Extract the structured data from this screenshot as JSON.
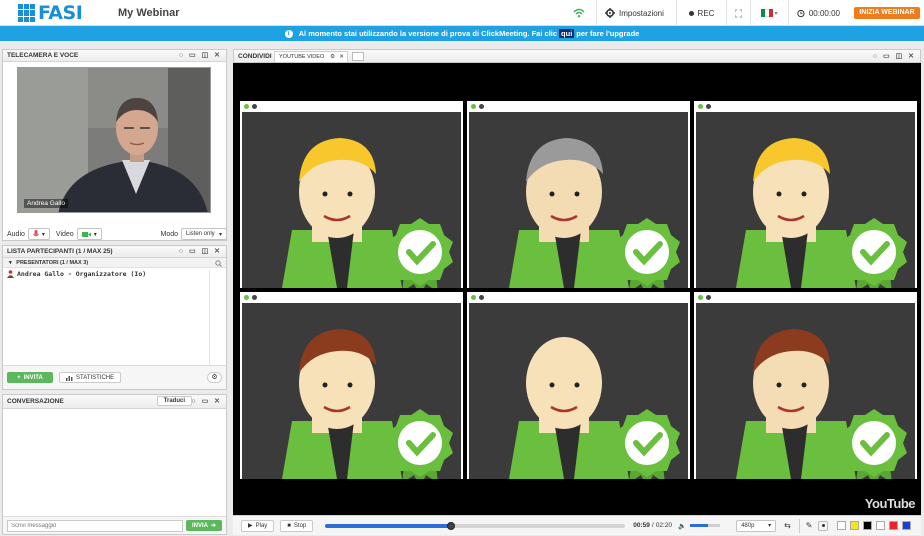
{
  "topbar": {
    "logo_text": "FASI",
    "webinar_title": "My Webinar",
    "settings_label": "Impostazioni",
    "rec_label": "REC",
    "timer": "00:00:00",
    "start_label": "INIZIA WEBINAR"
  },
  "notice": {
    "text_before": "Al momento stai utilizzando la versione di prova di ClickMeeting. Fai clic",
    "link": "qui",
    "text_after": "per fare l'upgrade"
  },
  "camera_panel": {
    "title": "TELECAMERA E VOCE",
    "presenter_name": "Andrea Gallo",
    "audio_label": "Audio",
    "video_label": "Video",
    "mode_label": "Modo",
    "mode_value": "Listen only"
  },
  "participants_panel": {
    "title": "LISTA PARTECIPANTI (1 / MAX 25)",
    "group_label": "PRESENTATORI (1 / MAX 3)",
    "participant": "Andrea Gallo - Organizzatore (Io)",
    "invite_label": "INVITA",
    "stats_label": "STATISTICHE"
  },
  "chat_panel": {
    "title": "CONVERSAZIONE",
    "translate_label": "Traduci",
    "placeholder": "Scrivi messaggio",
    "send_label": "INVIA"
  },
  "share_panel": {
    "title": "CONDIVIDI",
    "tab_label": "YOUTUBE VIDEO"
  },
  "player": {
    "play_label": "Play",
    "stop_label": "Stop",
    "time_current": "00:59",
    "time_total": "02:20",
    "progress": 0.42,
    "volume": 0.6,
    "quality": "480p",
    "watermark": "YouTube"
  },
  "colors": {
    "accent": "#1fa2e3",
    "start_button": "#f07b1c",
    "invite_green": "#5cb85c",
    "palette": [
      "#ffffff",
      "#f5e617",
      "#000000",
      "#ffffff",
      "#e8242a",
      "#1d3fd1"
    ]
  }
}
